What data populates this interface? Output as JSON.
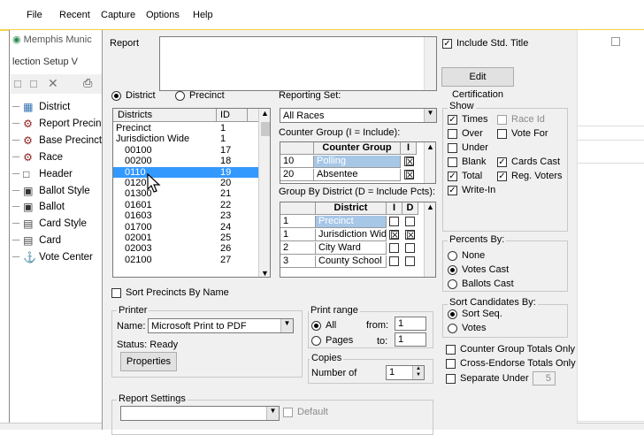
{
  "menu": [
    "File",
    "Recent",
    "Capture",
    "Options",
    "Help"
  ],
  "bg_window": {
    "title": "Memphis Munic",
    "menu": "lection  Setup  V",
    "tree": [
      {
        "label": "District",
        "icon": "grid-icon"
      },
      {
        "label": "Report Precin",
        "icon": "gear-icon"
      },
      {
        "label": "Base Precinct",
        "icon": "gear-icon"
      },
      {
        "label": "Race",
        "icon": "gear-icon"
      },
      {
        "label": "Header",
        "icon": "document-icon"
      },
      {
        "label": "Ballot Style",
        "icon": "ballot-icon"
      },
      {
        "label": "Ballot",
        "icon": "ballot-icon"
      },
      {
        "label": "Card Style",
        "icon": "card-icon"
      },
      {
        "label": "Card",
        "icon": "card-icon"
      },
      {
        "label": "Vote Center",
        "icon": "vote-center-icon"
      }
    ]
  },
  "report": {
    "label": "Report",
    "include_std_title": "Include Std. Title",
    "include_std_title_checked": true,
    "edit_certification": "Edit Certification"
  },
  "mode": {
    "district": "District",
    "precinct": "Precinct",
    "selected": "district"
  },
  "districts": {
    "col_districts": "Districts",
    "col_id": "ID",
    "rows": [
      {
        "name": "Precinct",
        "id": "1"
      },
      {
        "name": "Jurisdiction Wide",
        "id": "1"
      },
      {
        "name": "00100",
        "id": "17"
      },
      {
        "name": "00200",
        "id": "18"
      },
      {
        "name": "0110",
        "id": "19",
        "selected": true
      },
      {
        "name": "0120",
        "id": "20"
      },
      {
        "name": "01300",
        "id": "21"
      },
      {
        "name": "01601",
        "id": "22"
      },
      {
        "name": "01603",
        "id": "23"
      },
      {
        "name": "01700",
        "id": "24"
      },
      {
        "name": "02001",
        "id": "25"
      },
      {
        "name": "02003",
        "id": "26"
      },
      {
        "name": "02100",
        "id": "27"
      }
    ]
  },
  "reporting_set": {
    "label": "Reporting Set:",
    "value": "All Races"
  },
  "counter_group": {
    "label": "Counter Group (I = Include):",
    "col_name": "Counter Group",
    "col_i": "I",
    "rows": [
      {
        "id": "10",
        "name": "Polling",
        "include": true,
        "selected": true
      },
      {
        "id": "20",
        "name": "Absentee",
        "include": true
      }
    ]
  },
  "group_by_district": {
    "label": "Group By District (D = Include Pcts):",
    "col_name": "District",
    "col_i": "I",
    "col_d": "D",
    "rows": [
      {
        "id": "1",
        "name": "Precinct",
        "i": false,
        "d": false,
        "selected": true
      },
      {
        "id": "1",
        "name": "Jurisdiction Wid",
        "i": true,
        "d": true
      },
      {
        "id": "2",
        "name": "City Ward",
        "i": false,
        "d": false
      },
      {
        "id": "3",
        "name": "County School",
        "i": false,
        "d": false
      }
    ]
  },
  "show": {
    "label": "Show",
    "items": [
      {
        "label": "Times",
        "checked": true
      },
      {
        "label": "Race Id",
        "checked": false,
        "disabled": true
      },
      {
        "label": "Over",
        "checked": false
      },
      {
        "label": "Vote For",
        "checked": false
      },
      {
        "label": "Under",
        "checked": false
      },
      {
        "label": "Blank",
        "checked": false
      },
      {
        "label": "Cards Cast",
        "checked": true
      },
      {
        "label": "Total",
        "checked": true
      },
      {
        "label": "Reg. Voters",
        "checked": true
      },
      {
        "label": "Write-In",
        "checked": true
      }
    ]
  },
  "percents_by": {
    "label": "Percents By:",
    "options": [
      "None",
      "Votes Cast",
      "Ballots Cast"
    ],
    "selected": "Votes Cast"
  },
  "sort_candidates_by": {
    "label": "Sort Candidates By:",
    "options": [
      "Sort Seq.",
      "Votes"
    ],
    "selected": "Sort Seq."
  },
  "options": {
    "counter_group_totals_only": "Counter Group Totals Only",
    "cross_endorse_totals_only": "Cross-Endorse Totals Only",
    "separate_under": "Separate Under",
    "separate_under_value": "5"
  },
  "sort_precincts": "Sort Precincts By Name",
  "printer": {
    "label": "Printer",
    "name_label": "Name:",
    "name_value": "Microsoft Print to PDF",
    "status": "Status: Ready",
    "properties": "Properties"
  },
  "print_range": {
    "label": "Print range",
    "all": "All",
    "pages": "Pages",
    "from_label": "from:",
    "from_value": "1",
    "to_label": "to:",
    "to_value": "1",
    "selected": "All"
  },
  "copies": {
    "label": "Copies",
    "number_label": "Number of",
    "value": "1"
  },
  "report_settings": {
    "label": "Report Settings",
    "value": "",
    "default_label": "Default"
  },
  "colors": {
    "selection": "#a7c7e7",
    "list_selection": "#3399ff",
    "dialog_bg": "#f0f0f0",
    "menu_underline": "#f3d34a"
  }
}
